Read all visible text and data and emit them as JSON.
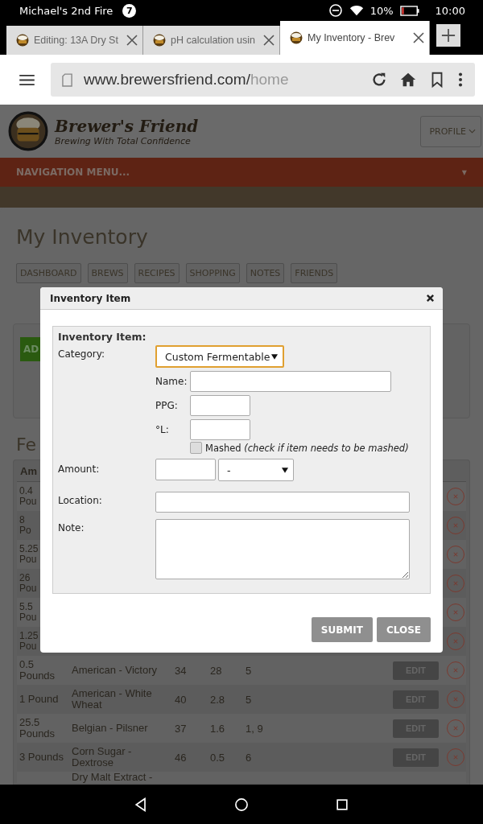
{
  "status_bar": {
    "device_name": "Michael's 2nd Fire",
    "notification_count": "7",
    "battery": "10%",
    "time": "10:00"
  },
  "browser_tabs": [
    {
      "title": "Editing: 13A Dry St",
      "selected": false
    },
    {
      "title": "pH calculation usin",
      "selected": false
    },
    {
      "title": "My Inventory - Brev",
      "selected": true
    }
  ],
  "address_bar": {
    "url_host": "www.brewersfriend.com/",
    "url_path": "home"
  },
  "site_header": {
    "logo_title": "Brewer's Friend",
    "tagline": "Brewing With Total Confidence",
    "profile_button": "PROFILE"
  },
  "navigation": {
    "label": "NAVIGATION MENU...",
    "caret": "▼"
  },
  "page": {
    "title": "My Inventory",
    "tabs": [
      {
        "label": "DASHBOARD",
        "selected": false
      },
      {
        "label": "BREWS",
        "selected": false
      },
      {
        "label": "RECIPES",
        "selected": false
      },
      {
        "label": "SHOPPING",
        "selected": false
      },
      {
        "label": "NOTES",
        "selected": false
      },
      {
        "label": "FRIENDS",
        "selected": false
      }
    ],
    "add_button": "AD",
    "section_heading": "Fe"
  },
  "table": {
    "columns": [
      "Am"
    ],
    "rows": [
      {
        "kind": "partial",
        "amount": "0.4 Pou"
      },
      {
        "kind": "partial",
        "amount": "8 Po"
      },
      {
        "kind": "partial",
        "amount": "5.25 Pou"
      },
      {
        "kind": "partial",
        "amount": "26 Pou"
      },
      {
        "kind": "partial",
        "amount": "5.5 Pou"
      },
      {
        "kind": "partial",
        "amount": "1.25 Pou"
      },
      {
        "kind": "full",
        "amount": "0.5 Pounds",
        "name": "American - Victory",
        "ppg": "34",
        "lovibond": "28",
        "column_5": "5",
        "edit": "EDIT"
      },
      {
        "kind": "full",
        "amount": "1 Pound",
        "name": "American - White Wheat",
        "ppg": "40",
        "lovibond": "2.8",
        "column_5": "5",
        "edit": "EDIT"
      },
      {
        "kind": "full",
        "amount": "25.5 Pounds",
        "name": "Belgian - Pilsner",
        "ppg": "37",
        "lovibond": "1.6",
        "column_5": "1, 9",
        "edit": "EDIT"
      },
      {
        "kind": "full",
        "amount": "3 Pounds",
        "name": "Corn Sugar - Dextrose",
        "ppg": "46",
        "lovibond": "0.5",
        "column_5": "6",
        "edit": "EDIT"
      },
      {
        "kind": "cut",
        "name": "Dry Malt Extract -"
      }
    ]
  },
  "modal": {
    "title": "Inventory Item",
    "legend": "Inventory Item:",
    "category": {
      "label": "Category:",
      "value": "Custom Fermentable",
      "focused": true
    },
    "name": {
      "label": "Name:"
    },
    "ppg": {
      "label": "PPG:"
    },
    "lovibond": {
      "label": "°L:"
    },
    "mashed": {
      "text": "Mashed *(check if item needs to be mashed)*",
      "checked": false
    },
    "amount": {
      "label": "Amount:",
      "unit": "-"
    },
    "location": {
      "label": "Location:"
    },
    "note": {
      "label": "Note:"
    },
    "buttons": [
      "SUBMIT",
      "CLOSE"
    ]
  }
}
